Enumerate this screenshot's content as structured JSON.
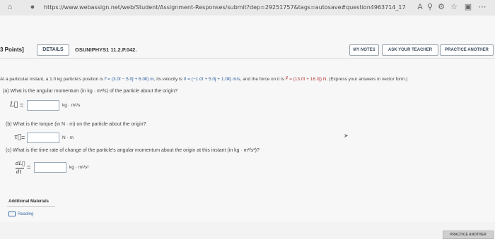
{
  "browser": {
    "url": "https://www.webassign.net/web/Student/Assignment-Responses/submit?dep=29251757&tags=autosave#question4963714_17",
    "icons": [
      "home-icon",
      "lock-icon",
      "read-aloud-icon",
      "zoom-icon",
      "extensions-icon",
      "favorites-icon",
      "collections-icon",
      "settings-icon"
    ]
  },
  "problem": {
    "points": "3 Points]",
    "details_label": "DETAILS",
    "problem_id": "OSUNIPHYS1 11.2.P.042.",
    "my_notes_label": "MY NOTES",
    "ask_teacher_label": "ASK YOUR TEACHER",
    "practice_another_label": "PRACTICE ANOTHER"
  },
  "statement": {
    "prefix": "At a particular instant, a 1.0 kg particle's position is",
    "r_vec": "r⃗ = (3.0î − 5.0ĵ + 6.0k̂) m,",
    "v_text": "its velocity is",
    "v_vec": "v⃗ = (−1.0î + 5.0ĵ + 1.0k̂) m/s,",
    "f_text": "and the force on it is",
    "f_vec": "F⃗ = (13.0î + 16.0ĵ) N.",
    "note": "(Express your answers in vector form.)"
  },
  "part_a": {
    "label": "(a)   What is the angular momentum (in kg · m²/s) of the particle about the origin?",
    "symbol": "L⃗",
    "unit": "kg · m²/s"
  },
  "part_b": {
    "label": "(b)   What is the torque (in N · m) on the particle about the origin?",
    "symbol": "τ⃗",
    "unit": "N · m"
  },
  "part_c": {
    "label": "(c)   What is the time rate of change of the particle's angular momentum about the origin at this instant (in kg · m²/s²)?",
    "symbol_top": "dL⃗",
    "symbol_bottom": "dt",
    "unit": "kg · m²/s²"
  },
  "resources": {
    "header": "Additional Materials",
    "reading_label": "Reading"
  },
  "footer": {
    "practice_another_label": "PRACTICE ANOTHER"
  }
}
